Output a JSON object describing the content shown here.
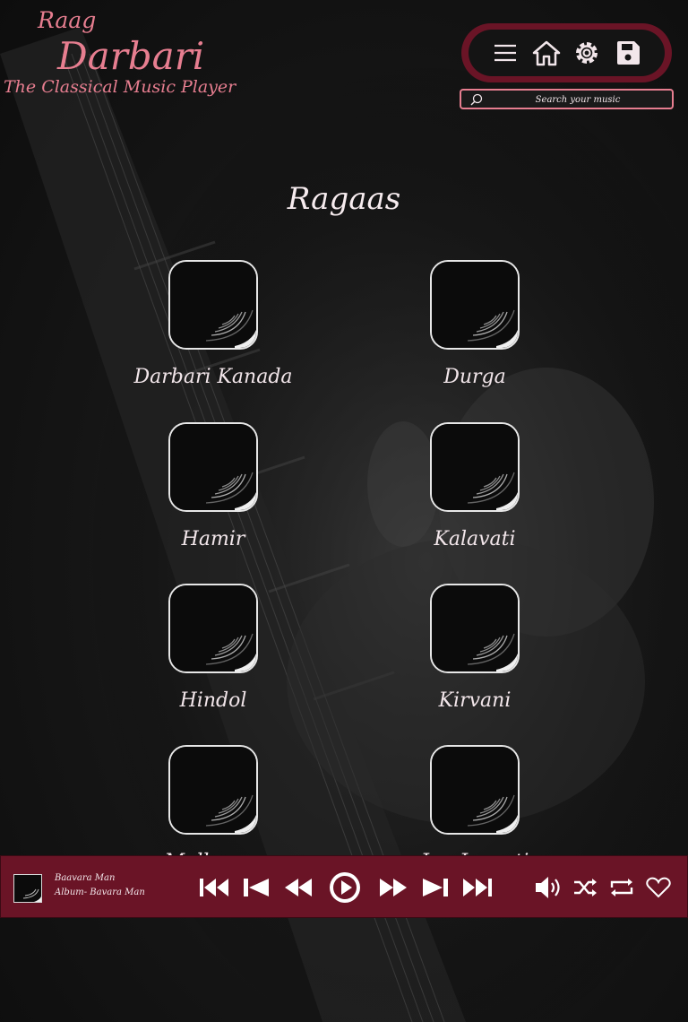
{
  "app": {
    "logo_line1": "Raag",
    "logo_line2": "Darbari",
    "logo_line3": "The Classical Music Player"
  },
  "toolbar": {
    "icons": [
      "menu-icon",
      "home-icon",
      "gear-icon",
      "save-icon"
    ]
  },
  "search": {
    "placeholder": "Search your music"
  },
  "section": {
    "title": "Ragaas"
  },
  "ragas": [
    {
      "name": "Darbari Kanada"
    },
    {
      "name": "Durga"
    },
    {
      "name": "Hamir"
    },
    {
      "name": "Kalavati"
    },
    {
      "name": "Hindol"
    },
    {
      "name": "Kirvani"
    },
    {
      "name": "Malkauns"
    },
    {
      "name": "Jog Jayanti"
    }
  ],
  "player": {
    "song": "Baavara Man",
    "album": "Album- Bavara Man",
    "icons": [
      "skip-start-icon",
      "previous-icon",
      "rewind-icon",
      "play-icon",
      "fast-forward-icon",
      "next-icon",
      "skip-end-icon",
      "volume-icon",
      "shuffle-icon",
      "repeat-icon",
      "heart-icon"
    ]
  },
  "colors": {
    "accent": "#e77e90",
    "player_bg": "#6a1426",
    "background": "#171717"
  }
}
